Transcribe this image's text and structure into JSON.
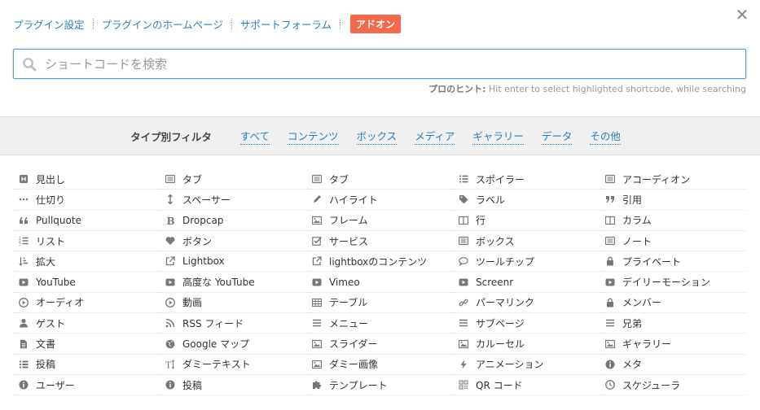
{
  "topbar": {
    "plugin_settings": "プラグイン設定",
    "plugin_homepage": "プラグインのホームページ",
    "support_forum": "サポートフォーラム",
    "addons": "アドオン",
    "close_symbol": "✕"
  },
  "search": {
    "placeholder": "ショートコードを検索",
    "value": ""
  },
  "hint": {
    "label": "プロのヒント:",
    "text": "Hit enter to select highlighted shortcode, while searching"
  },
  "filters": {
    "label": "タイプ別フィルタ",
    "items": [
      "すべて",
      "コンテンツ",
      "ボックス",
      "メディア",
      "ギャラリー",
      "データ",
      "その他"
    ]
  },
  "shortcodes": [
    {
      "label": "見出し",
      "icon": "heading-icon"
    },
    {
      "label": "タブ",
      "icon": "tabs-icon"
    },
    {
      "label": "タブ",
      "icon": "tab-icon"
    },
    {
      "label": "スポイラー",
      "icon": "list-icon"
    },
    {
      "label": "アコーディオン",
      "icon": "list-alt-icon"
    },
    {
      "label": "仕切り",
      "icon": "ellipsis-icon"
    },
    {
      "label": "スペーサー",
      "icon": "arrows-v-icon"
    },
    {
      "label": "ハイライト",
      "icon": "pencil-icon"
    },
    {
      "label": "ラベル",
      "icon": "tag-icon"
    },
    {
      "label": "引用",
      "icon": "quote-right-icon"
    },
    {
      "label": "Pullquote",
      "icon": "quote-left-icon"
    },
    {
      "label": "Dropcap",
      "icon": "bold-icon"
    },
    {
      "label": "フレーム",
      "icon": "picture-icon"
    },
    {
      "label": "行",
      "icon": "columns-icon"
    },
    {
      "label": "カラム",
      "icon": "columns-alt-icon"
    },
    {
      "label": "リスト",
      "icon": "list-ol-icon"
    },
    {
      "label": "ボタン",
      "icon": "heart-icon"
    },
    {
      "label": "サービス",
      "icon": "check-square-icon"
    },
    {
      "label": "ボックス",
      "icon": "list-alt-box-icon"
    },
    {
      "label": "ノート",
      "icon": "list-alt-note-icon"
    },
    {
      "label": "拡大",
      "icon": "sort-amount-icon"
    },
    {
      "label": "Lightbox",
      "icon": "external-link-icon"
    },
    {
      "label": "lightboxのコンテンツ",
      "icon": "external-link-alt-icon"
    },
    {
      "label": "ツールチップ",
      "icon": "comment-icon"
    },
    {
      "label": "プライベート",
      "icon": "lock-icon"
    },
    {
      "label": "YouTube",
      "icon": "youtube-play-icon"
    },
    {
      "label": "高度な YouTube",
      "icon": "youtube-play-alt-icon"
    },
    {
      "label": "Vimeo",
      "icon": "youtube-play-vimeo-icon"
    },
    {
      "label": "Screenr",
      "icon": "youtube-play-screenr-icon"
    },
    {
      "label": "デイリーモーション",
      "icon": "youtube-play-daily-icon"
    },
    {
      "label": "オーディオ",
      "icon": "play-circle-icon"
    },
    {
      "label": "動画",
      "icon": "play-circle-alt-icon"
    },
    {
      "label": "テーブル",
      "icon": "table-icon"
    },
    {
      "label": "パーマリンク",
      "icon": "link-icon"
    },
    {
      "label": "メンバー",
      "icon": "lock-member-icon"
    },
    {
      "label": "ゲスト",
      "icon": "user-icon"
    },
    {
      "label": "RSS フィード",
      "icon": "rss-icon"
    },
    {
      "label": "メニュー",
      "icon": "bars-icon"
    },
    {
      "label": "サブページ",
      "icon": "bars-sub-icon"
    },
    {
      "label": "兄弟",
      "icon": "bars-sibling-icon"
    },
    {
      "label": "文書",
      "icon": "file-text-icon"
    },
    {
      "label": "Google マップ",
      "icon": "globe-icon"
    },
    {
      "label": "スライダー",
      "icon": "picture-slider-icon"
    },
    {
      "label": "カルーセル",
      "icon": "picture-carousel-icon"
    },
    {
      "label": "ギャラリー",
      "icon": "picture-gallery-icon"
    },
    {
      "label": "投稿",
      "icon": "th-list-icon"
    },
    {
      "label": "ダミーテキスト",
      "icon": "text-height-icon"
    },
    {
      "label": "ダミー画像",
      "icon": "picture-dummy-icon"
    },
    {
      "label": "アニメーション",
      "icon": "bolt-icon"
    },
    {
      "label": "メタ",
      "icon": "info-circle-icon"
    },
    {
      "label": "ユーザー",
      "icon": "info-circle-user-icon"
    },
    {
      "label": "投稿",
      "icon": "info-circle-post-icon"
    },
    {
      "label": "テンプレート",
      "icon": "puzzle-icon"
    },
    {
      "label": "QR コード",
      "icon": "qrcode-icon"
    },
    {
      "label": "スケジューラ",
      "icon": "clock-icon"
    }
  ],
  "colors": {
    "link": "#2a7fbf",
    "addon_button": "#f26a4b",
    "icon": "#777777"
  }
}
